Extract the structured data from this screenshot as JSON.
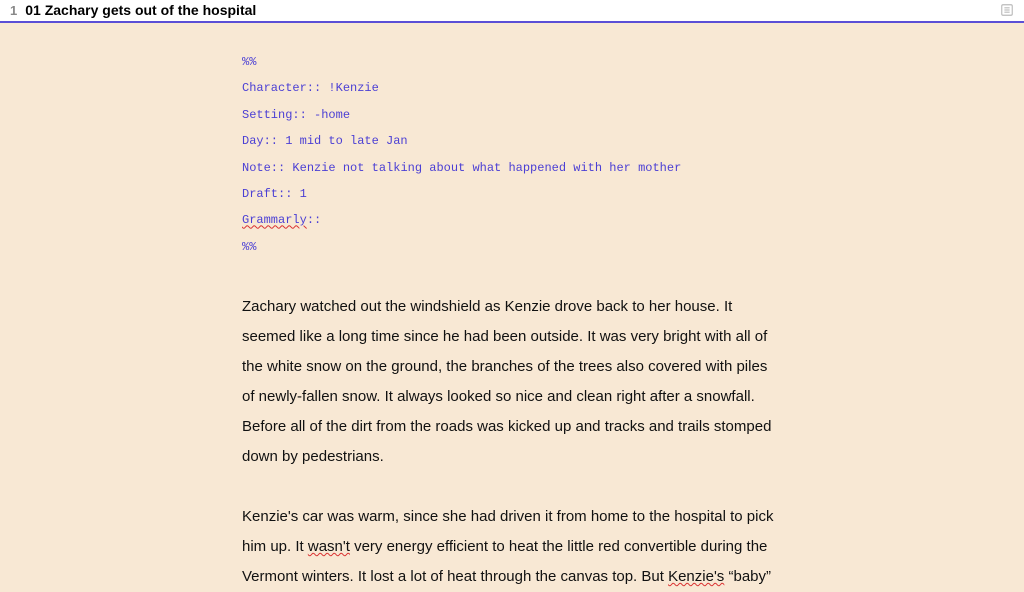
{
  "header": {
    "number": "1",
    "title": "01 Zachary gets out of the hospital"
  },
  "meta": {
    "delim_open": "%%",
    "lines": [
      {
        "label": "Character::",
        "value": " !Kenzie"
      },
      {
        "label": "Setting::",
        "value": " -home"
      },
      {
        "label": "Day::",
        "value": " 1 mid to late Jan"
      },
      {
        "label": "Note::",
        "value": " Kenzie not talking about what happened with her mother"
      },
      {
        "label": "Draft::",
        "value": " 1"
      }
    ],
    "grammarly_label": "Grammarly",
    "grammarly_suffix": "::",
    "delim_close": "%%"
  },
  "prose": {
    "p1": "Zachary watched out the windshield as Kenzie drove back to her house. It seemed like a long time since he had been outside. It was very bright with all of the white snow on the ground, the branches of the trees also covered with piles of newly-fallen snow. It always looked so nice and clean right after a snowfall. Before all of the dirt from the roads was kicked up and tracks and trails stomped down by pedestrians.",
    "p2_a": "Kenzie's car was warm, since she had driven it from home to the hospital to pick him up. It ",
    "p2_wasnt": "wasn't",
    "p2_b": " very energy efficient to heat the little red convertible during the Vermont winters. It lost a lot of heat through the canvas top. But ",
    "p2_kenzies": "Kenzie's",
    "p2_c": " “baby”"
  }
}
